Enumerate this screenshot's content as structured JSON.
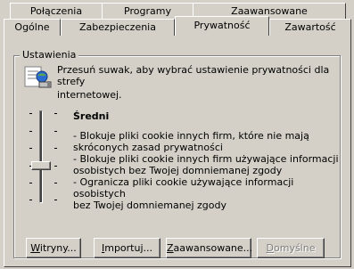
{
  "tabs_back": [
    {
      "label": "Połączenia"
    },
    {
      "label": "Programy"
    },
    {
      "label": "Zaawansowane"
    }
  ],
  "tabs_front": [
    {
      "label": "Ogólne"
    },
    {
      "label": "Zabezpieczenia"
    },
    {
      "label": "Prywatność",
      "active": true
    },
    {
      "label": "Zawartość"
    }
  ],
  "settings": {
    "group_label": "Ustawienia",
    "intro": [
      "Przesuń suwak, aby wybrać ustawienie prywatności dla strefy",
      "internetowej."
    ],
    "level_title": "Średni",
    "description": [
      "- Blokuje pliki cookie innych firm, które nie mają",
      "skróconych zasad prywatności",
      "- Blokuje pliki cookie innych firm używające informacji",
      "osobistych bez Twojej domniemanej zgody",
      "- Ogranicza pliki cookie używające informacji osobistych",
      "bez Twojej domniemanej zgody"
    ],
    "slider_position": "3 of 6"
  },
  "buttons": {
    "sites": {
      "underline": "W",
      "rest": "itryny..."
    },
    "import": {
      "underline": "I",
      "rest": "mportuj..."
    },
    "advanced": {
      "underline": "Z",
      "rest": "aawansowane..."
    },
    "default": {
      "underline": "D",
      "rest": "omyślne",
      "disabled": true
    }
  },
  "colors": {
    "face": "#d4d0c8",
    "shadow": "#808080",
    "dark": "#404040",
    "highlight": "#ffffff"
  }
}
